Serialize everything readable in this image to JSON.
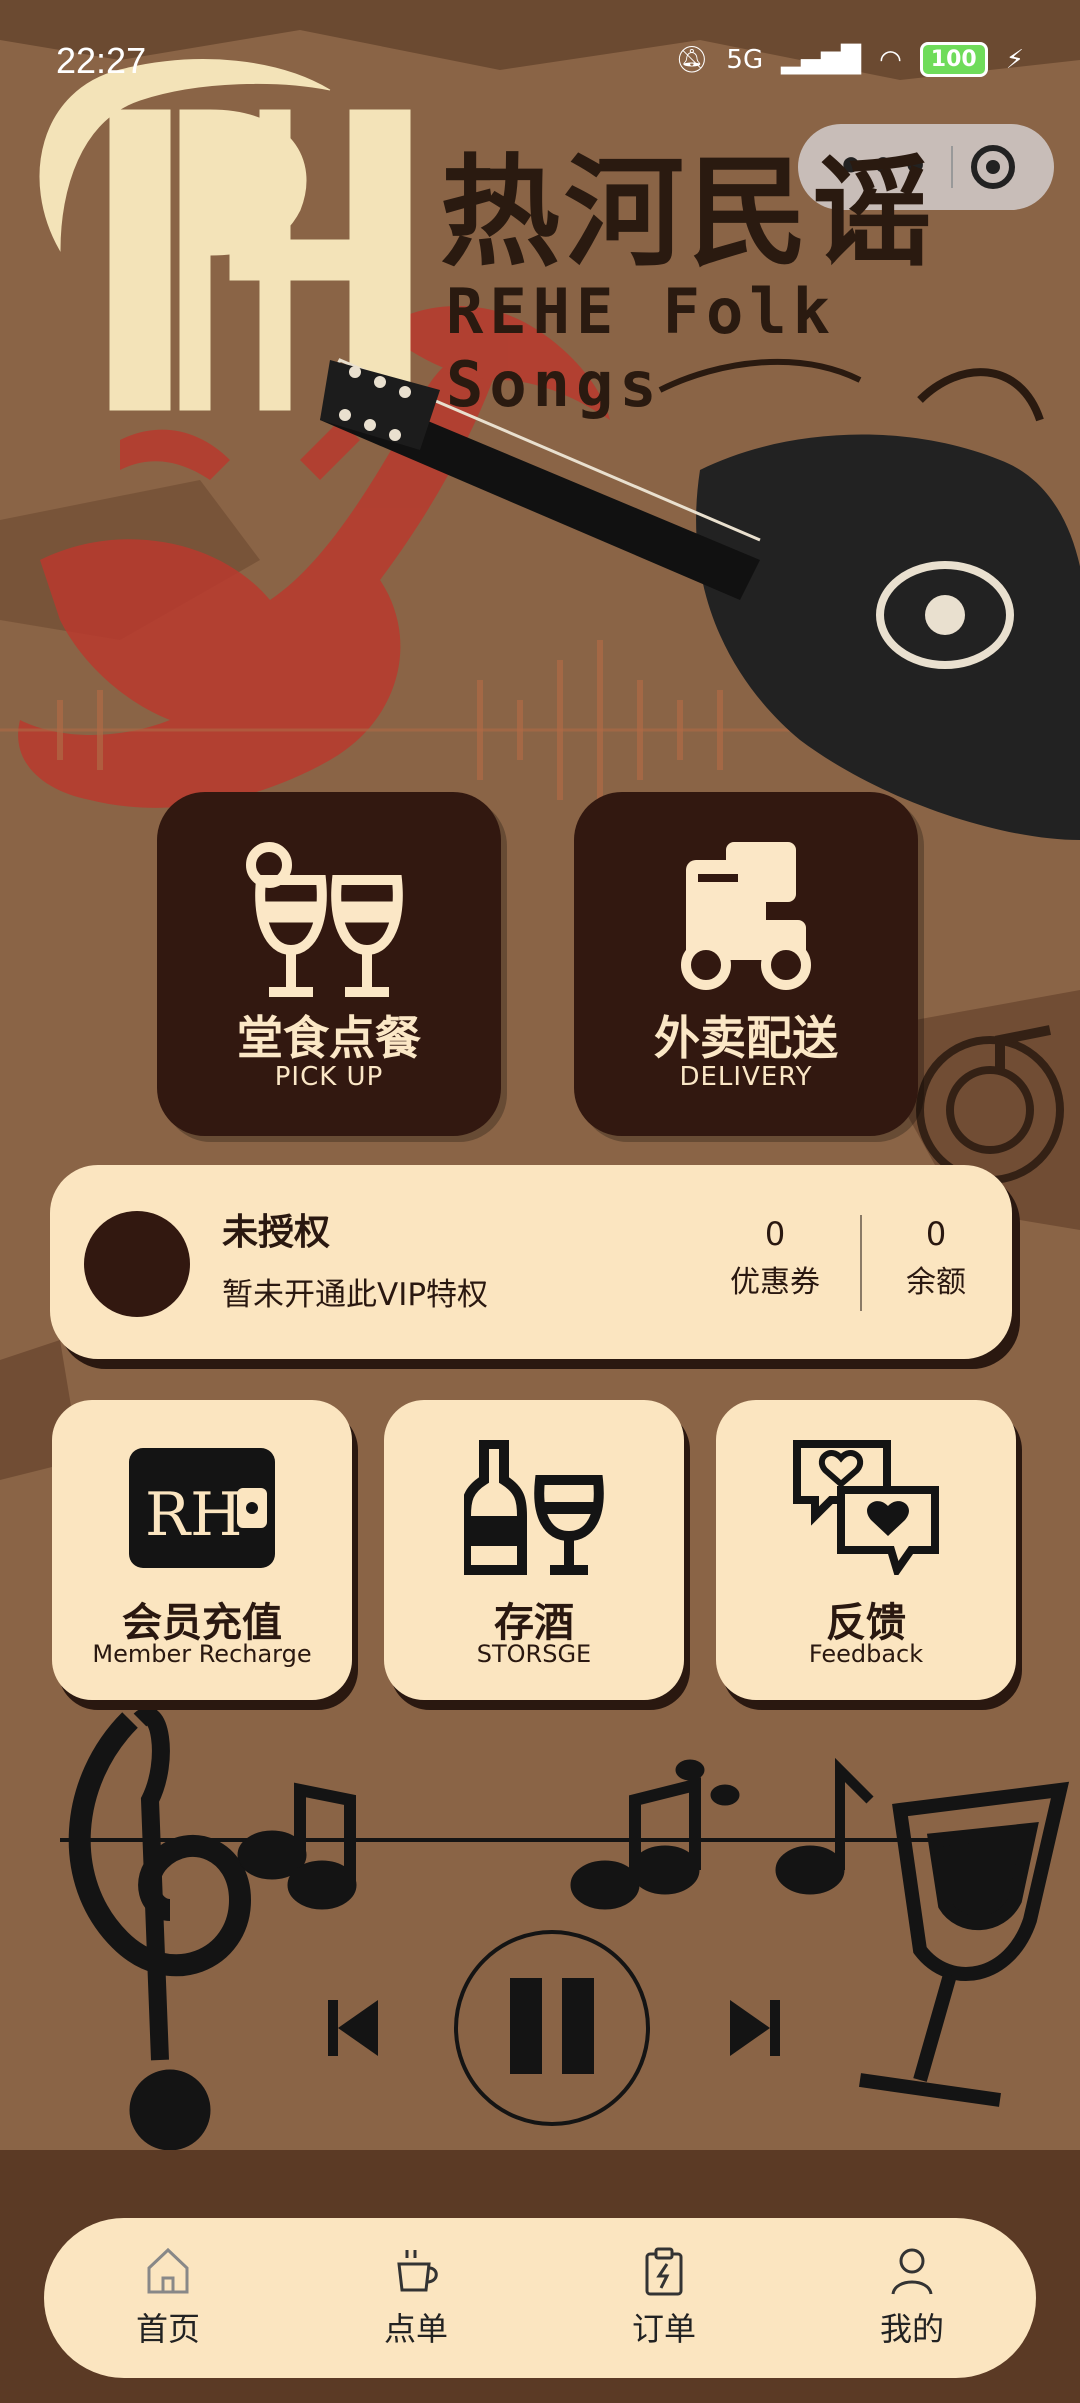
{
  "status_bar": {
    "time": "22:27",
    "network": "5G",
    "battery": "100"
  },
  "brand": {
    "logo_text": "RH",
    "name_cn": "热河民谣",
    "name_en": "REHE Folk Songs"
  },
  "big_cards": [
    {
      "title": "堂食点餐",
      "subtitle": "PICK UP",
      "icon": "wine-glasses-icon"
    },
    {
      "title": "外卖配送",
      "subtitle": "DELIVERY",
      "icon": "delivery-truck-icon"
    }
  ],
  "member": {
    "title": "未授权",
    "desc": "暂未开通此VIP特权",
    "coupons_value": "0",
    "coupons_label": "优惠券",
    "balance_value": "0",
    "balance_label": "余额"
  },
  "small_cards": [
    {
      "title": "会员充值",
      "subtitle": "Member Recharge",
      "icon": "member-card-icon"
    },
    {
      "title": "存酒",
      "subtitle": "STORSGE",
      "icon": "bottle-glass-icon"
    },
    {
      "title": "反馈",
      "subtitle": "Feedback",
      "icon": "heart-chat-icon"
    }
  ],
  "tabbar": [
    {
      "label": "首页",
      "icon": "home-icon"
    },
    {
      "label": "点单",
      "icon": "coffee-cup-icon"
    },
    {
      "label": "订单",
      "icon": "clipboard-icon"
    },
    {
      "label": "我的",
      "icon": "user-icon"
    }
  ],
  "colors": {
    "background": "#8a6446",
    "card_dark": "#321810",
    "card_light": "#fbe5c0",
    "accent_red": "#b83a2e"
  }
}
